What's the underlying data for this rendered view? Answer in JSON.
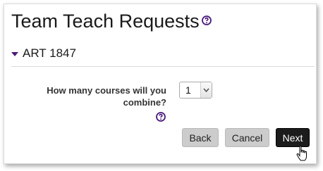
{
  "page": {
    "title": "Team Teach Requests",
    "title_help_icon": "help-circle-icon"
  },
  "section": {
    "heading": "ART 1847",
    "toggle_icon": "triangle-down-icon"
  },
  "form": {
    "question": "How many courses will you combine?",
    "question_help_icon": "help-circle-icon",
    "courses_select": {
      "selected": "1",
      "arrow_icon": "chevron-down-icon"
    }
  },
  "buttons": {
    "back": "Back",
    "cancel": "Cancel",
    "next": "Next"
  },
  "colors": {
    "accent": "#4a1a7a",
    "primary_button": "#1c1c1c",
    "secondary_button": "#cccccc"
  },
  "cursor": {
    "icon": "hand-pointer-icon"
  }
}
